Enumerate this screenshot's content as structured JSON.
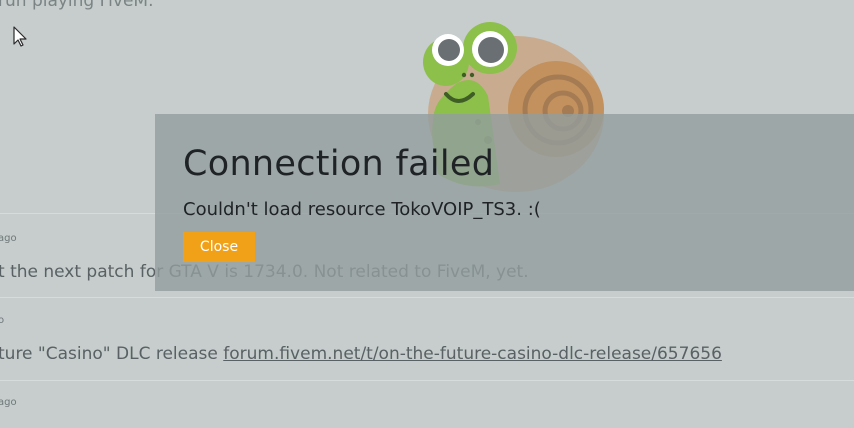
{
  "feed": {
    "top_partial": "run playing FiveM.",
    "items": [
      {
        "meta": "ago",
        "text": "t the next patch for GTA V is 1734.0. Not related to FiveM, yet."
      },
      {
        "meta": "o",
        "text": "ture \"Casino\" DLC release ",
        "link": "forum.fivem.net/t/on-the-future-casino-dlc-release/657656"
      },
      {
        "meta": "ago"
      }
    ]
  },
  "dialog": {
    "title": "Connection failed",
    "message": "Couldn't load resource TokoVOIP_TS3. :(",
    "close_label": "Close"
  },
  "colors": {
    "accent": "#f1a118",
    "overlay": "#929e9e"
  },
  "icons": [
    "cursor-icon",
    "snail-mascot-icon"
  ]
}
